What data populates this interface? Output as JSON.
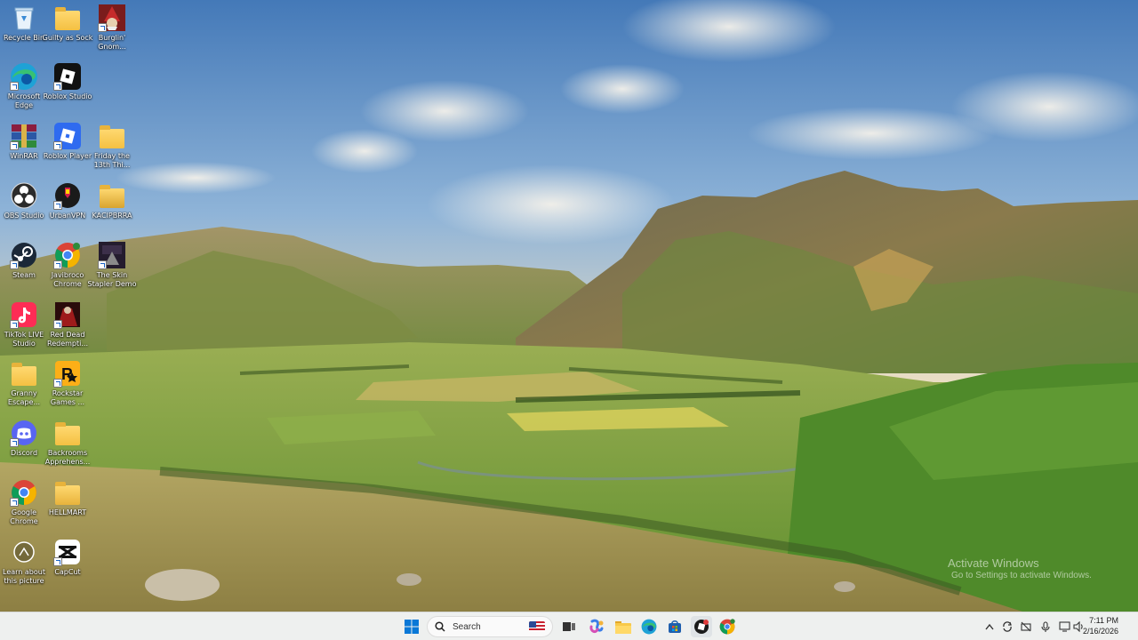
{
  "desktop": {
    "icons": [
      {
        "label": "Recycle Bin",
        "icon": "recycle-bin-icon"
      },
      {
        "label": "Guilty as Sock",
        "icon": "folder-icon"
      },
      {
        "label": "Burglin' Gnom...",
        "icon": "game-icon"
      },
      {
        "label": "Microsoft Edge",
        "icon": "edge-icon"
      },
      {
        "label": "Roblox Studio",
        "icon": "roblox-studio-icon"
      },
      {
        "label": "WinRAR",
        "icon": "winrar-icon"
      },
      {
        "label": "Roblox Player",
        "icon": "roblox-player-icon"
      },
      {
        "label": "Friday the 13th Thi...",
        "icon": "folder-icon"
      },
      {
        "label": "OBS Studio",
        "icon": "obs-icon"
      },
      {
        "label": "UrbanVPN",
        "icon": "vpn-icon"
      },
      {
        "label": "KACIPBRRA",
        "icon": "folder-icon"
      },
      {
        "label": "Steam",
        "icon": "steam-icon"
      },
      {
        "label": "Javibroco Chrome",
        "icon": "chrome-icon"
      },
      {
        "label": "The Skin Stapler Demo",
        "icon": "game-icon"
      },
      {
        "label": "TikTok LIVE Studio",
        "icon": "tiktok-icon"
      },
      {
        "label": "Red Dead Redempti...",
        "icon": "game-icon"
      },
      {
        "label": "Granny Escape...",
        "icon": "folder-icon"
      },
      {
        "label": "Rockstar Games ...",
        "icon": "rockstar-icon"
      },
      {
        "label": "Discord",
        "icon": "discord-icon"
      },
      {
        "label": "Backrooms Apprehens...",
        "icon": "folder-icon"
      },
      {
        "label": "Google Chrome",
        "icon": "chrome-icon"
      },
      {
        "label": "HELLMART",
        "icon": "folder-icon"
      },
      {
        "label": "Learn about this picture",
        "icon": "info-icon"
      },
      {
        "label": "CapCut",
        "icon": "capcut-icon"
      }
    ]
  },
  "watermark": {
    "line1": "Activate Windows",
    "line2": "Go to Settings to activate Windows."
  },
  "taskbar": {
    "search_label": "Search",
    "pinned": [
      "start-icon",
      "task-view-icon",
      "copilot-icon",
      "file-explorer-icon",
      "edge-icon",
      "store-icon",
      "roblox-studio-icon",
      "chrome-icon"
    ],
    "time": "7:11 PM",
    "date": "2/16/2026"
  },
  "colors": {
    "sky_top": "#4f86c3",
    "sky_bottom": "#f1e3c4",
    "grass": "#7ea33c",
    "taskbar": "#eef0ef"
  }
}
